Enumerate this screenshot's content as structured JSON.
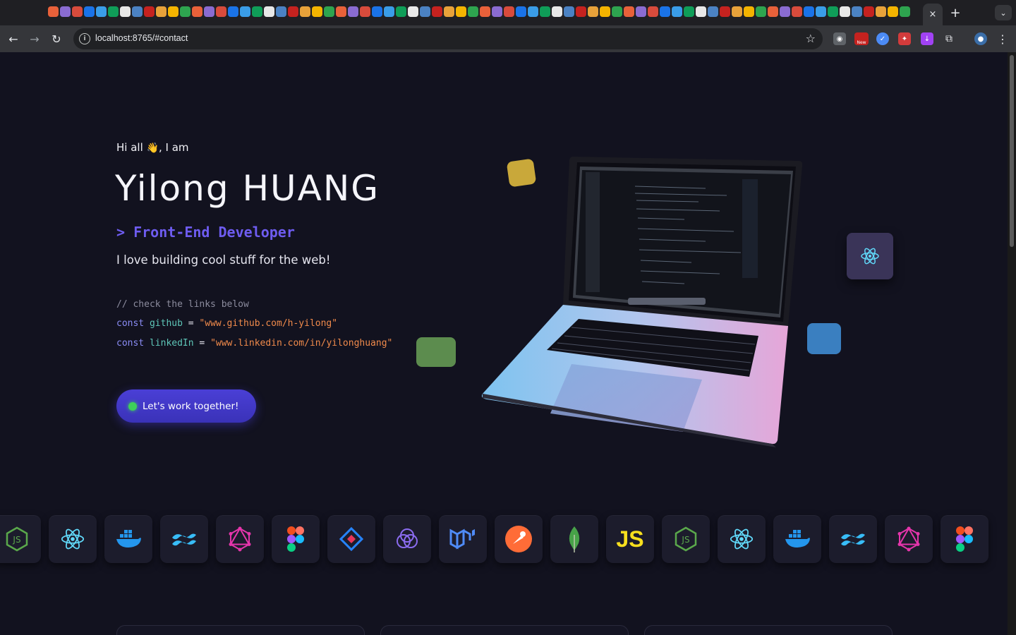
{
  "browser": {
    "url": "localhost:8765/#contact",
    "tab_close": "×",
    "new_tab": "+",
    "tab_search": "⌄",
    "back": "←",
    "forward": "→",
    "reload": "↻",
    "bookmark": "☆",
    "menu": "⋮",
    "extensions": [
      "camera-icon",
      "new-badge-icon",
      "compass-icon",
      "puzzle-red-icon",
      "download-icon",
      "puzzle-icon",
      "profile-icon"
    ],
    "extension_badge": "New"
  },
  "hero": {
    "greeting_prefix": "Hi all",
    "greeting_emoji": "👋",
    "greeting_suffix": ", I am",
    "name": "Yilong HUANG",
    "role": "> Front-End Developer",
    "tagline": "I love building cool stuff for the web!",
    "code": {
      "comment": "// check the links below",
      "line1_kw": "const",
      "line1_var": "github",
      "line1_op": "=",
      "line1_str": "\"www.github.com/h-yilong\"",
      "line2_kw": "const",
      "line2_var": "linkedIn",
      "line2_op": "=",
      "line2_str": "\"www.linkedin.com/in/yilonghuang\""
    },
    "cta": "Let's work together!"
  },
  "tech_icons": [
    "nodejs-icon",
    "react-icon",
    "docker-icon",
    "tailwind-icon",
    "graphql-icon",
    "figma-icon",
    "jira-icon",
    "apollo-icon",
    "mui-icon",
    "postman-icon",
    "mongodb-icon",
    "javascript-icon",
    "nodejs-icon",
    "react-icon",
    "docker-icon",
    "tailwind-icon",
    "graphql-icon",
    "figma-icon"
  ],
  "tech_js_label": "JS",
  "colors": {
    "accent": "#6e5cf0",
    "background": "#12121f",
    "cta": "#4a3fd6",
    "string": "#f08a4b",
    "variable": "#5ec6b8"
  }
}
